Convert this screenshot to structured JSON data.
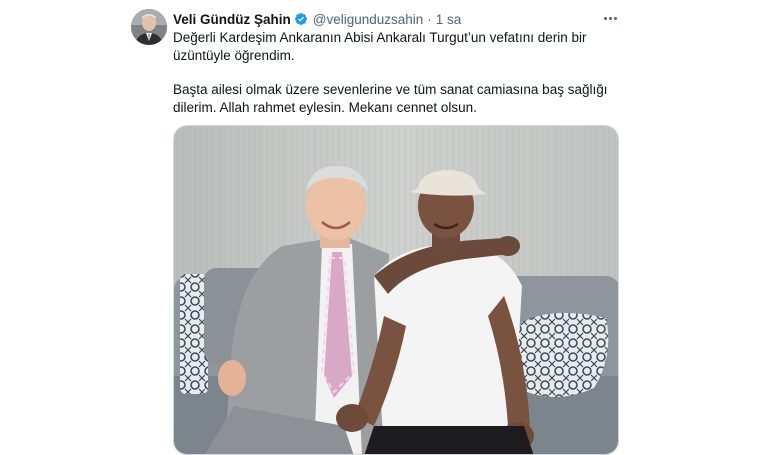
{
  "author": {
    "display_name": "Veli Gündüz Şahin",
    "handle": "@veligunduzsahin",
    "separator": "·",
    "time": "1 sa",
    "verified_icon": "verified-badge-icon",
    "verified_color": "#1d9bf0"
  },
  "tweet": {
    "paragraph_1": "Değerli Kardeşim Ankaranın Abisi Ankaralı Turgut’un vefatını derin bir üzüntüyle öğrendim.",
    "paragraph_2": "Başta ailesi olmak üzere sevenlerine ve tüm sanat camiasına baş sağlığı dilerim. Allah rahmet eylesin. Mekanı cennet olsun."
  },
  "menu": {
    "icon": "more-horizontal-icon"
  },
  "colors": {
    "text_primary": "#0f1419",
    "text_secondary": "#536471",
    "border": "#cfd9de"
  }
}
